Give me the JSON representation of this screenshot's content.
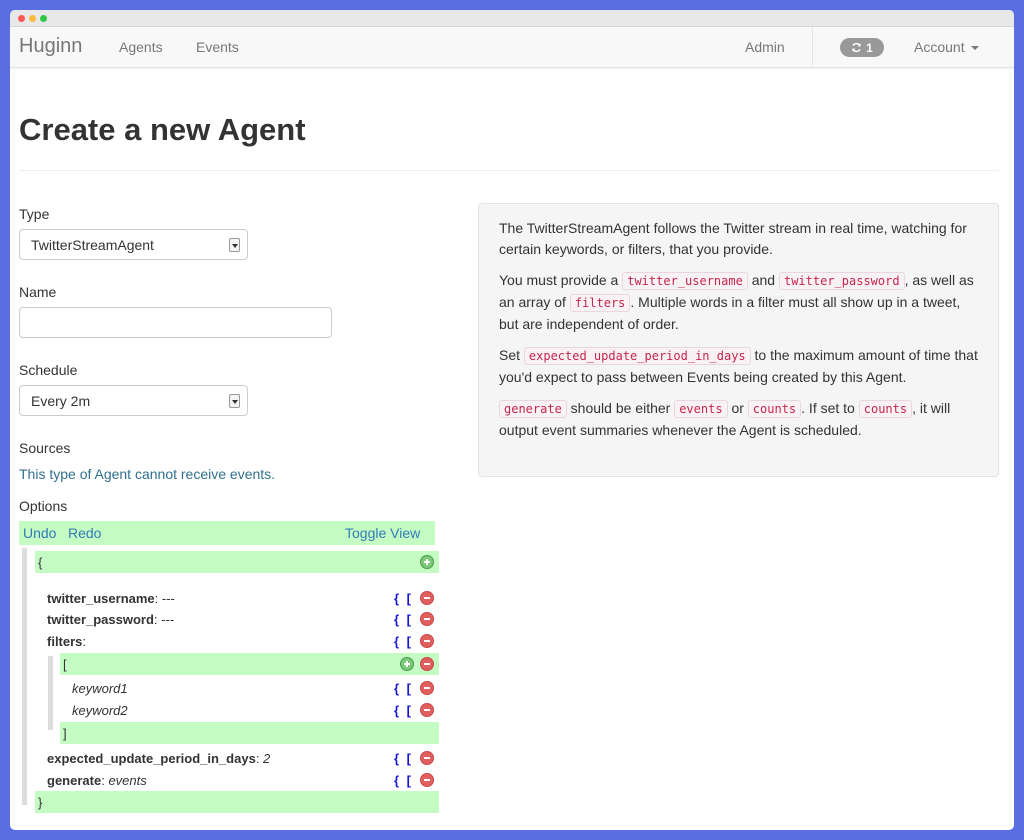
{
  "navbar": {
    "brand": "Huginn",
    "links": [
      "Agents",
      "Events"
    ],
    "admin": "Admin",
    "job_count": "1",
    "account": "Account"
  },
  "page": {
    "title": "Create a new Agent"
  },
  "form": {
    "type_label": "Type",
    "type_value": "TwitterStreamAgent",
    "name_label": "Name",
    "name_value": "",
    "schedule_label": "Schedule",
    "schedule_value": "Every 2m",
    "sources_label": "Sources",
    "sources_note": "This type of Agent cannot receive events.",
    "options_label": "Options"
  },
  "editor": {
    "undo": "Undo",
    "redo": "Redo",
    "toggle": "Toggle View",
    "open_brace": "{",
    "close_brace": "}",
    "open_bracket": "[",
    "close_bracket": "]",
    "bracket_buttons": "{ [",
    "rows": [
      {
        "key": "twitter_username",
        "value": "---"
      },
      {
        "key": "twitter_password",
        "value": "---"
      },
      {
        "key": "filters",
        "value": ""
      },
      {
        "key": "expected_update_period_in_days",
        "value": "2"
      },
      {
        "key": "generate",
        "value": "events"
      }
    ],
    "filters": [
      "keyword1",
      "keyword2"
    ]
  },
  "help": {
    "p1": "The TwitterStreamAgent follows the Twitter stream in real time, watching for certain keywords, or filters, that you provide.",
    "p2_a": "You must provide a ",
    "p2_code1": "twitter_username",
    "p2_b": " and ",
    "p2_code2": "twitter_password",
    "p2_c": ", as well as an array of ",
    "p2_code3": "filters",
    "p2_d": ". Multiple words in a filter must all show up in a tweet, but are independent of order.",
    "p3_a": "Set ",
    "p3_code1": "expected_update_period_in_days",
    "p3_b": " to the maximum amount of time that you'd expect to pass between Events being created by this Agent.",
    "p4_code1": "generate",
    "p4_a": " should be either ",
    "p4_code2": "events",
    "p4_b": " or ",
    "p4_code3": "counts",
    "p4_c": ". If set to ",
    "p4_code4": "counts",
    "p4_d": ", it will output event summaries whenever the Agent is scheduled."
  },
  "colors": {
    "background": "#5b6ee1",
    "editor_green": "#c4fcc4",
    "link_blue": "#337ab7",
    "code_red": "#c7254e"
  }
}
